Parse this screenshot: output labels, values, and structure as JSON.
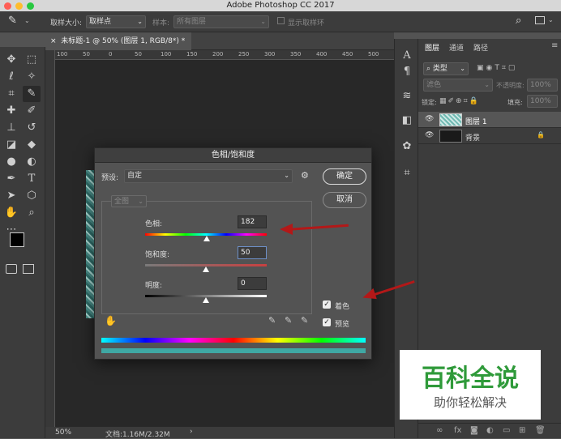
{
  "app": {
    "title": "Adobe Photoshop CC 2017"
  },
  "options_bar": {
    "sample_size_label": "取样大小:",
    "sample_size_value": "取样点",
    "sample_label": "样本:",
    "sample_value": "所有图层",
    "show_ring_label": "显示取样环"
  },
  "document": {
    "tab_title": "未标题-1 @ 50% (图层 1, RGB/8*) *",
    "ruler_ticks": [
      "100",
      "50",
      "0",
      "50",
      "100",
      "150",
      "200",
      "250",
      "300",
      "350",
      "400",
      "450",
      "500"
    ],
    "zoom": "50%",
    "doc_size": "文档:1.16M/2.32M"
  },
  "layers_panel": {
    "tabs": [
      "图层",
      "通道",
      "路径"
    ],
    "filter_label": "类型",
    "blend_mode": "滤色",
    "opacity_label": "不透明度:",
    "opacity_value": "100%",
    "lock_label": "锁定:",
    "fill_label": "填充:",
    "fill_value": "100%",
    "layers": [
      {
        "name": "图层 1",
        "selected": true
      },
      {
        "name": "背景",
        "selected": false,
        "locked": true
      }
    ]
  },
  "dialog": {
    "title": "色相/饱和度",
    "preset_label": "预设:",
    "preset_value": "自定",
    "channel_value": "全图",
    "ok_label": "确定",
    "cancel_label": "取消",
    "hue_label": "色相:",
    "hue_value": "182",
    "saturation_label": "饱和度:",
    "saturation_value": "50",
    "lightness_label": "明度:",
    "lightness_value": "0",
    "colorize_label": "着色",
    "colorize_checked": true,
    "preview_label": "预览",
    "preview_checked": true
  },
  "watermark": {
    "title": "百科全说",
    "subtitle": "助你轻松解决"
  },
  "colors": {
    "accent_arrow": "#b31818",
    "watermark_green": "#2f9a3a"
  }
}
